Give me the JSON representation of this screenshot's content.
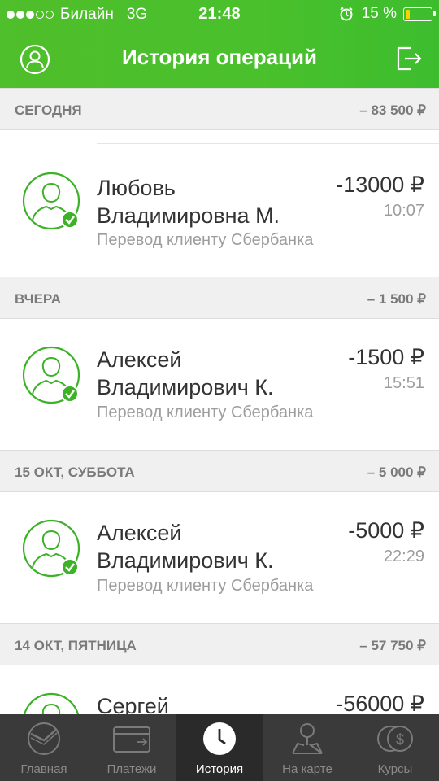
{
  "status_bar": {
    "carrier": "Билайн",
    "network": "3G",
    "time": "21:48",
    "battery_percent": "15 %",
    "battery_level": 0.15,
    "signal_bars_filled": 3,
    "signal_bars_total": 5
  },
  "header": {
    "title": "История операций",
    "left_icon": "profile-icon",
    "right_icon": "exit-icon"
  },
  "sections": [
    {
      "label": "СЕГОДНЯ",
      "total": "– 83 500 ₽"
    },
    {
      "label": "ВЧЕРА",
      "total": "– 1 500 ₽"
    },
    {
      "label": "15 ОКТ, СУББОТА",
      "total": "– 5 000 ₽"
    },
    {
      "label": "14 ОКТ, ПЯТНИЦА",
      "total": "– 57 750 ₽"
    }
  ],
  "transactions": [
    {
      "name_line1": "Любовь",
      "name_line2": "Владимировна М.",
      "description": "Перевод клиенту Сбербанка",
      "amount": "-13000 ₽",
      "time": "10:07"
    },
    {
      "name_line1": "Алексей",
      "name_line2": "Владимирович К.",
      "description": "Перевод клиенту Сбербанка",
      "amount": "-1500 ₽",
      "time": "15:51"
    },
    {
      "name_line1": "Алексей",
      "name_line2": "Владимирович К.",
      "description": "Перевод клиенту Сбербанка",
      "amount": "-5000 ₽",
      "time": "22:29"
    },
    {
      "name_line1": "Сергей",
      "amount": "-56000 ₽"
    }
  ],
  "tabbar": [
    {
      "label": "Главная",
      "icon": "sberbank-logo-icon",
      "active": false
    },
    {
      "label": "Платежи",
      "icon": "payment-card-icon",
      "active": false
    },
    {
      "label": "История",
      "icon": "clock-icon",
      "active": true
    },
    {
      "label": "На карте",
      "icon": "map-pin-icon",
      "active": false
    },
    {
      "label": "Курсы",
      "icon": "currency-coins-icon",
      "active": false
    }
  ],
  "colors": {
    "brand_green": "#4fbf2b",
    "check_green": "#3cb227",
    "tabbar_bg": "#3a3a3a",
    "battery_yellow": "#f4d400"
  }
}
